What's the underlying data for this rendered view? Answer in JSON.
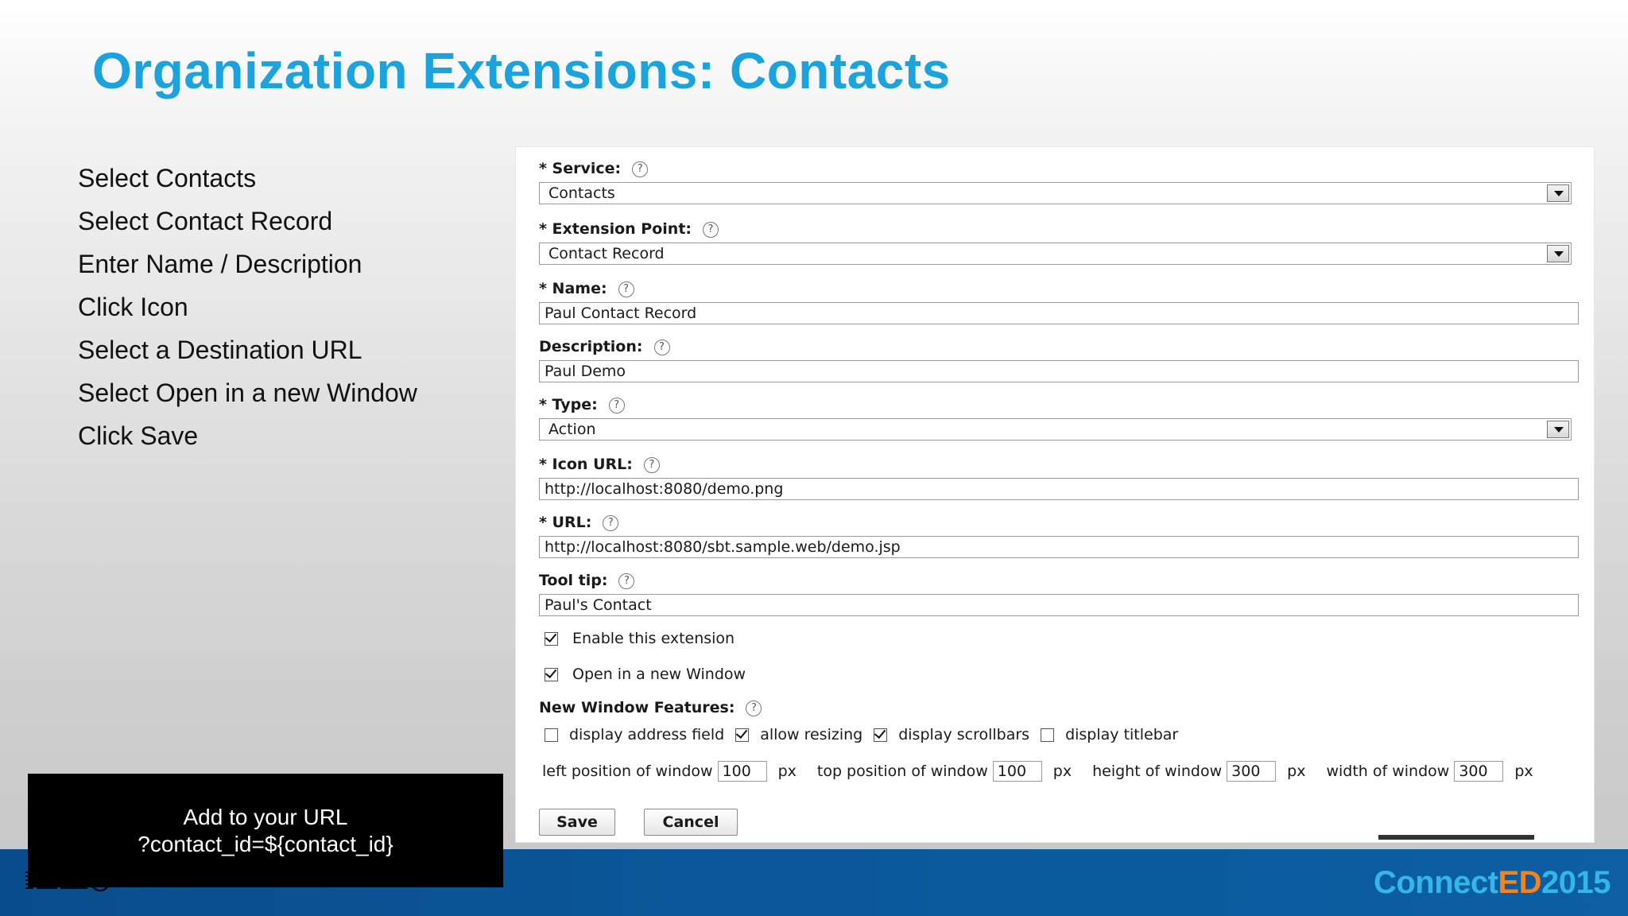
{
  "slide": {
    "title": "Organization Extensions: Contacts",
    "steps": [
      "Select Contacts",
      "Select Contact Record",
      "Enter Name / Description",
      "Click Icon",
      "Select a Destination URL",
      "Select Open in a new Window",
      "Click Save"
    ]
  },
  "form": {
    "service": {
      "label": "* Service:",
      "value": "Contacts"
    },
    "extension_point": {
      "label": "* Extension Point:",
      "value": "Contact Record"
    },
    "name": {
      "label": "* Name:",
      "value": "Paul Contact Record"
    },
    "description": {
      "label": "Description:",
      "value": "Paul Demo"
    },
    "type": {
      "label": "* Type:",
      "value": "Action"
    },
    "icon_url": {
      "label": "*  Icon URL:",
      "value": "http://localhost:8080/demo.png"
    },
    "url": {
      "label": "* URL:",
      "value": "http://localhost:8080/sbt.sample.web/demo.jsp"
    },
    "tooltip": {
      "label": "Tool tip:",
      "value": "Paul's Contact"
    },
    "enable_extension": {
      "label": "Enable this extension",
      "checked": true
    },
    "open_new_window": {
      "label": "Open in a new Window",
      "checked": true
    },
    "new_window_features": {
      "label": "New Window Features:",
      "display_address_field": {
        "label": "display address field",
        "checked": false
      },
      "allow_resizing": {
        "label": "allow resizing",
        "checked": true
      },
      "display_scrollbars": {
        "label": "display scrollbars",
        "checked": true
      },
      "display_titlebar": {
        "label": "display titlebar",
        "checked": false
      }
    },
    "window_position": {
      "left_label": "left position of window",
      "left_value": "100",
      "top_label": "top position of window",
      "top_value": "100",
      "height_label": "height of window",
      "height_value": "300",
      "width_label": "width of window",
      "width_value": "300",
      "unit": "px"
    },
    "help_glyph": "?",
    "save_label": "Save",
    "cancel_label": "Cancel"
  },
  "callout": {
    "line1": "Add to your URL",
    "line2": "?contact_id=${contact_id}"
  },
  "footer": {
    "brand_connect": "Connect",
    "brand_ed": "ED",
    "brand_year": "2015",
    "colors": {
      "connect": "#33b7ea",
      "ed": "#f5821f",
      "bar": "#0a5a9d"
    }
  },
  "icons": [
    "help-icon",
    "dropdown-arrow-icon",
    "checkbox-icon",
    "ibm-logo"
  ]
}
